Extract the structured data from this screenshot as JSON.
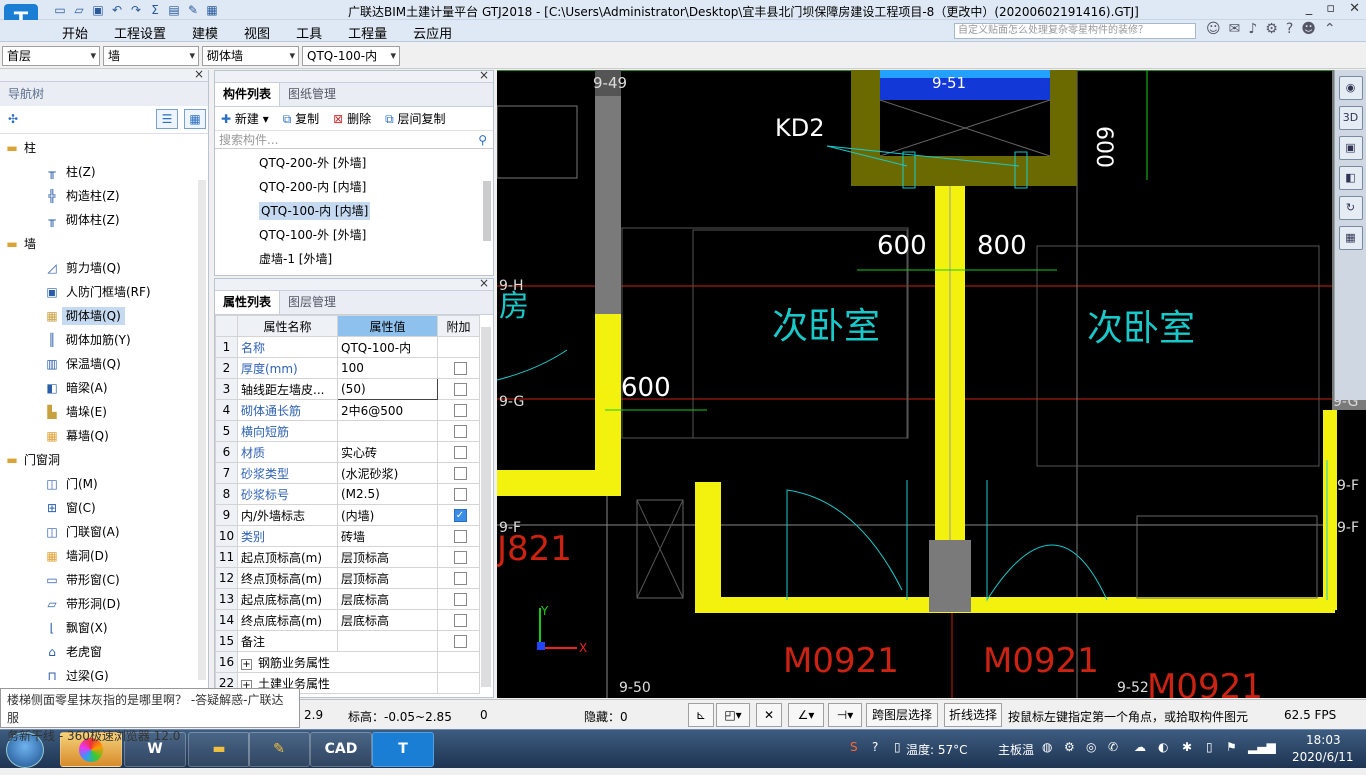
{
  "window": {
    "title": "广联达BIM土建计量平台 GTJ2018 - [C:\\Users\\Administrator\\Desktop\\宜丰县北门坝保障房建设工程项目-8（更改中）(20200602191416).GTJ]",
    "logo_letter": "T",
    "controls": [
      "_",
      "▫",
      "✕"
    ]
  },
  "menu": [
    "开始",
    "工程设置",
    "建模",
    "视图",
    "工具",
    "工程量",
    "云应用"
  ],
  "help_search": {
    "placeholder": "自定义贴面怎么处理复杂零星构件的装修？"
  },
  "selectors": {
    "floor": "首层",
    "category": "墙",
    "type": "砌体墙",
    "component": "QTQ-100-内"
  },
  "nav_tree": {
    "title": "导航树",
    "groups": [
      {
        "label": "柱",
        "items": [
          "柱(Z)",
          "构造柱(Z)",
          "砌体柱(Z)"
        ]
      },
      {
        "label": "墙",
        "items": [
          "剪力墙(Q)",
          "人防门框墙(RF)",
          "砌体墙(Q)",
          "砌体加筋(Y)",
          "保温墙(Q)",
          "暗梁(A)",
          "墙垛(E)",
          "幕墙(Q)"
        ]
      },
      {
        "label": "门窗洞",
        "items": [
          "门(M)",
          "窗(C)",
          "门联窗(A)",
          "墙洞(D)",
          "带形窗(C)",
          "带形洞(D)",
          "飘窗(X)",
          "老虎窗",
          "过梁(G)"
        ]
      }
    ],
    "selected": "砌体墙(Q)"
  },
  "component_panel": {
    "tabs": [
      "构件列表",
      "图纸管理"
    ],
    "tools": [
      "新建",
      "复制",
      "删除",
      "层间复制"
    ],
    "search_placeholder": "搜索构件...",
    "items": [
      "QTQ-200-外 [外墙]",
      "QTQ-200-内 [内墙]",
      "QTQ-100-内 [内墙]",
      "QTQ-100-外 [外墙]",
      "虚墙-1 [外墙]"
    ],
    "selected_index": 2
  },
  "property_panel": {
    "tabs": [
      "属性列表",
      "图层管理"
    ],
    "headers": [
      "属性名称",
      "属性值",
      "附加"
    ],
    "rows": [
      {
        "n": "1",
        "name": "名称",
        "value": "QTQ-100-内",
        "blue": true,
        "check": null
      },
      {
        "n": "2",
        "name": "厚度(mm)",
        "value": "100",
        "blue": true,
        "check": false
      },
      {
        "n": "3",
        "name": "轴线距左墙皮...",
        "value": "(50)",
        "blue": false,
        "check": false
      },
      {
        "n": "4",
        "name": "砌体通长筋",
        "value": "2中6@500",
        "blue": true,
        "check": false
      },
      {
        "n": "5",
        "name": "横向短筋",
        "value": "",
        "blue": true,
        "check": false
      },
      {
        "n": "6",
        "name": "材质",
        "value": "实心砖",
        "blue": true,
        "check": false
      },
      {
        "n": "7",
        "name": "砂浆类型",
        "value": "(水泥砂浆)",
        "blue": true,
        "check": false
      },
      {
        "n": "8",
        "name": "砂浆标号",
        "value": "(M2.5)",
        "blue": true,
        "check": false
      },
      {
        "n": "9",
        "name": "内/外墙标志",
        "value": "(内墙)",
        "blue": false,
        "check": true
      },
      {
        "n": "10",
        "name": "类别",
        "value": "砖墙",
        "blue": true,
        "check": false
      },
      {
        "n": "11",
        "name": "起点顶标高(m)",
        "value": "层顶标高",
        "blue": false,
        "check": false
      },
      {
        "n": "12",
        "name": "终点顶标高(m)",
        "value": "层顶标高",
        "blue": false,
        "check": false
      },
      {
        "n": "13",
        "name": "起点底标高(m)",
        "value": "层底标高",
        "blue": false,
        "check": false
      },
      {
        "n": "14",
        "name": "终点底标高(m)",
        "value": "层底标高",
        "blue": false,
        "check": false
      },
      {
        "n": "15",
        "name": "备注",
        "value": "",
        "blue": false,
        "check": false
      },
      {
        "n": "16",
        "name": "钢筋业务属性",
        "value": "",
        "blue": false,
        "check": null,
        "expand": true
      },
      {
        "n": "22",
        "name": "土建业务属性",
        "value": "",
        "blue": false,
        "check": null,
        "expand": true
      }
    ]
  },
  "drawing": {
    "axis_labels": [
      "9-49",
      "9-51",
      "9-H",
      "9-G",
      "9-F",
      "9-F",
      "9-G",
      "9-F",
      "9-50",
      "9-52"
    ],
    "texts": [
      "KD2",
      "600",
      "600",
      "800",
      "600",
      "次卧室",
      "次卧室",
      "M0921",
      "M0921",
      "M0921",
      "J821",
      "房"
    ],
    "axis_x": "X",
    "axis_y": "Y"
  },
  "status_bar": {
    "coord": "2.9",
    "elevation": "标高：-0.05~2.85",
    "count": "0",
    "hidden": "隐藏：0",
    "btn_cross_layer": "跨图层选择",
    "btn_polyline": "折线选择",
    "hint": "按鼠标左键指定第一个角点，或拾取构件图元",
    "fps": "62.5 FPS"
  },
  "tooltip": {
    "line1": "楼梯侧面零星抹灰指的是哪里啊？ -答疑解惑-广联达服",
    "line2": "务新干线 - 360极速浏览器 12.0"
  },
  "taskbar": {
    "apps": [
      "W",
      "CAD",
      "T"
    ],
    "cpu_temp": "温度: 57°C",
    "board_label": "主板温",
    "time": "18:03",
    "date": "2020/6/11"
  }
}
